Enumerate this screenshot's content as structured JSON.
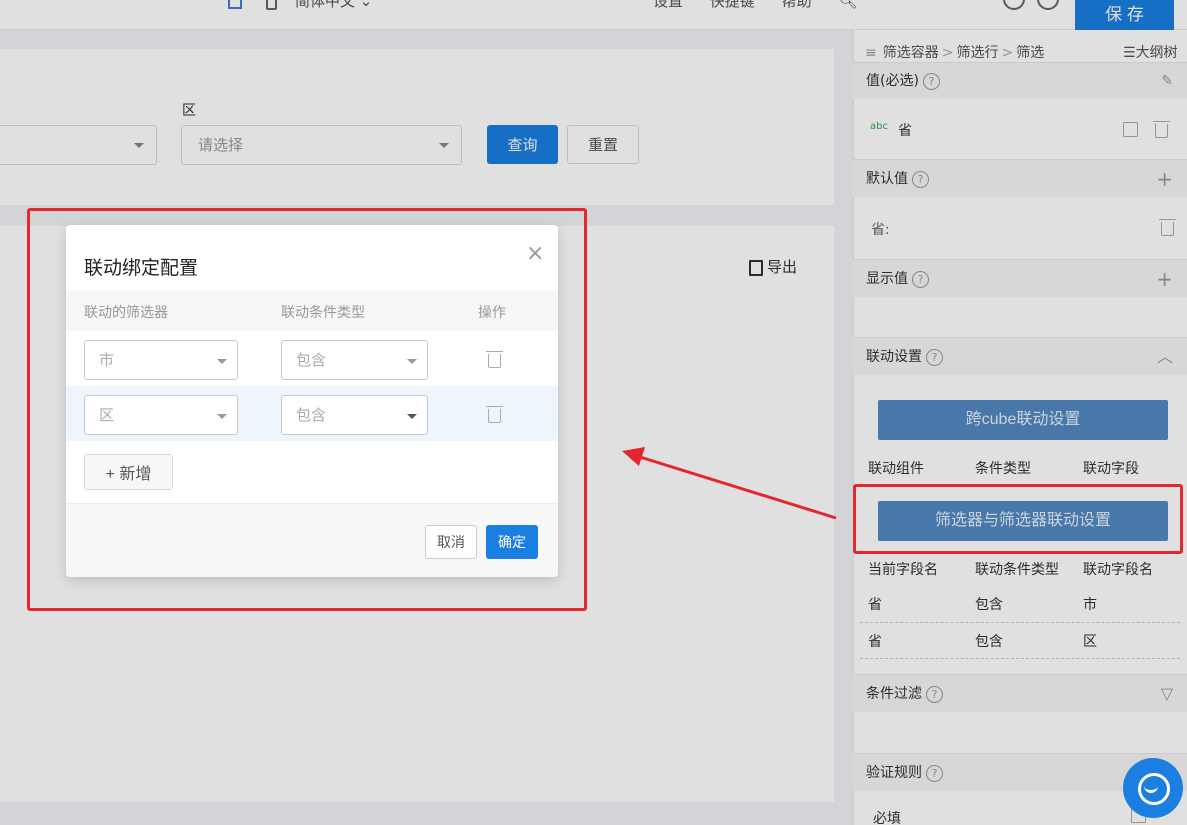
{
  "topbar": {
    "language": "简体中文 ⌄",
    "links": [
      "设置",
      "快捷键",
      "帮助"
    ],
    "save_label": "保 存"
  },
  "filter": {
    "district_label": "区",
    "district_placeholder": "请选择",
    "query_label": "查询",
    "reset_label": "重置"
  },
  "content": {
    "export_label": "导出"
  },
  "panel": {
    "breadcrumb": [
      "筛选容器",
      "筛选行",
      "筛选"
    ],
    "breadcrumb_sep": ">",
    "outline_label": "大纲树",
    "value_section": "值(必选)",
    "value_type": "abc",
    "value_name": "省",
    "default_section": "默认值",
    "default_value": "省:",
    "display_section": "显示值",
    "linkage_section": "联动设置",
    "cross_cube_button": "跨cube联动设置",
    "table1_headers": [
      "联动组件",
      "条件类型",
      "联动字段"
    ],
    "filter_linkage_button": "筛选器与筛选器联动设置",
    "table2_headers": [
      "当前字段名",
      "联动条件类型",
      "联动字段名"
    ],
    "table2_rows": [
      [
        "省",
        "包含",
        "市"
      ],
      [
        "省",
        "包含",
        "区"
      ]
    ],
    "condition_section": "条件过滤",
    "validation_section": "验证规则",
    "validation_required": "必填",
    "plus": "+",
    "help_mark": "?"
  },
  "modal": {
    "title": "联动绑定配置",
    "close": "×",
    "headers": [
      "联动的筛选器",
      "联动条件类型",
      "操作"
    ],
    "rows": [
      {
        "filter": "市",
        "condition": "包含"
      },
      {
        "filter": "区",
        "condition": "包含"
      }
    ],
    "add_label": "+ 新增",
    "cancel_label": "取消",
    "ok_label": "确定"
  },
  "colors": {
    "primary": "#1a7fe0",
    "panel_button": "#5288c1",
    "highlight": "#e4262d"
  }
}
